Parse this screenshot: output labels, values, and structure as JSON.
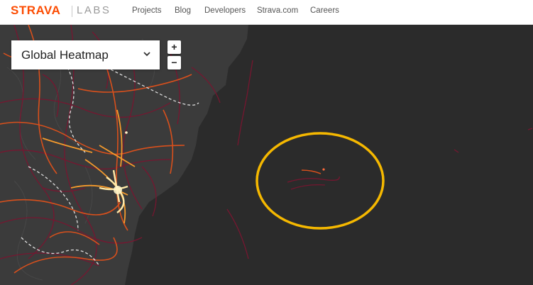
{
  "header": {
    "logo_brand": "STRAVA",
    "logo_suffix": "LABS",
    "nav": [
      {
        "label": "Projects"
      },
      {
        "label": "Blog"
      },
      {
        "label": "Developers"
      },
      {
        "label": "Strava.com"
      },
      {
        "label": "Careers"
      }
    ]
  },
  "map": {
    "layer_selector": {
      "selected": "Global Heatmap"
    },
    "zoom_in_label": "+",
    "zoom_out_label": "−",
    "icons": {
      "dropdown": "chevron-down-icon"
    },
    "colors": {
      "brand": "#fc4c02",
      "water": "#2b2b2b",
      "land": "#3a3a3a",
      "heat_low": "#7a1530",
      "heat_mid": "#d9501c",
      "heat_high": "#ffe9a8",
      "highlight": "#f5b800"
    }
  }
}
